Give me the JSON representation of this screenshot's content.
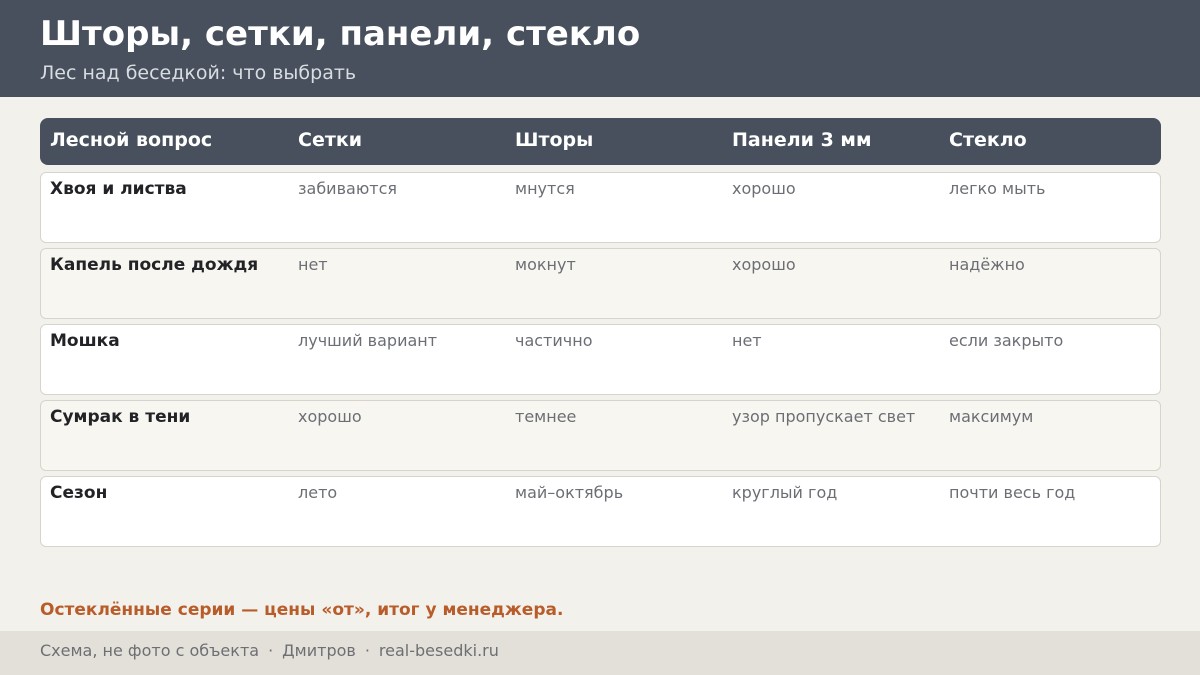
{
  "header": {
    "title": "Шторы, сетки, панели, стекло",
    "subtitle": "Лес над беседкой: что выбрать"
  },
  "table": {
    "columns": [
      "Лесной вопрос",
      "Сетки",
      "Шторы",
      "Панели 3 мм",
      "Стекло"
    ],
    "rows": [
      [
        "Хвоя и листва",
        "забиваются",
        "мнутся",
        "хорошо",
        "легко мыть"
      ],
      [
        "Капель после дождя",
        "нет",
        "мокнут",
        "хорошо",
        "надёжно"
      ],
      [
        "Мошка",
        "лучший вариант",
        "частично",
        "нет",
        "если закрыто"
      ],
      [
        "Сумрак в тени",
        "хорошо",
        "темнее",
        "узор пропускает свет",
        "максимум"
      ],
      [
        "Сезон",
        "лето",
        "май–октябрь",
        "круглый год",
        "почти весь год"
      ]
    ]
  },
  "note": "Остеклённые серии — цены «от», итог у менеджера.",
  "footer": {
    "parts": [
      "Схема, не фото с объекта",
      "Дмитров",
      "real-besedki.ru"
    ],
    "separator": "·"
  },
  "colors": {
    "header_bg": "#47505c",
    "accent": "#b85c2a",
    "page_bg": "#f3f1ec",
    "footer_bg": "#e3e0d9"
  }
}
